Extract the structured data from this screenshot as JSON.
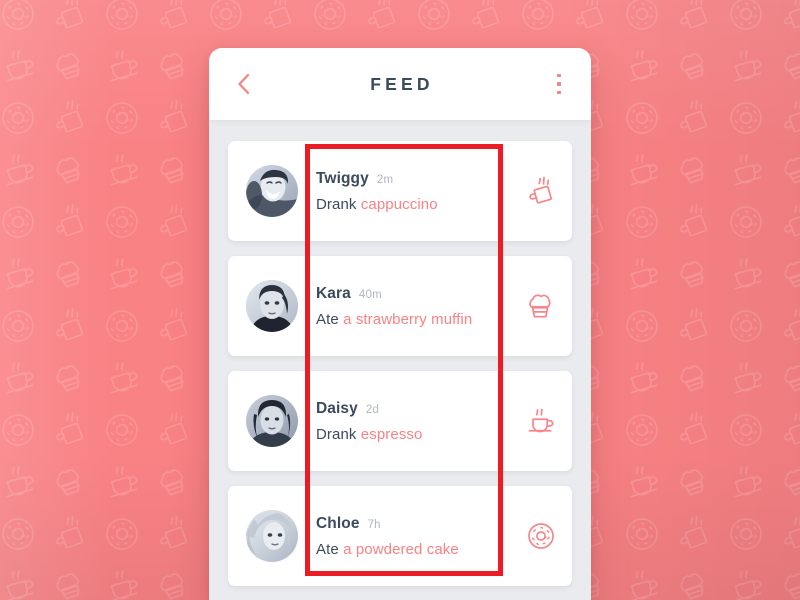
{
  "background": {
    "color": "#F98285",
    "pattern_icons": [
      "donut-icon",
      "mug-icon",
      "espresso-cup-icon",
      "muffin-icon"
    ],
    "pattern_color": "#FB9295"
  },
  "header": {
    "title": "FEED",
    "back_icon": "chevron-left-icon",
    "menu_icon": "overflow-menu-icon",
    "accent": "#F88487",
    "title_color": "#3C4A5E"
  },
  "feed": {
    "items": [
      {
        "name": "Twiggy",
        "time": "2m",
        "verb": "Drank",
        "item": "cappuccino",
        "icon": "mug-icon",
        "avatar": "avatar-twiggy"
      },
      {
        "name": "Kara",
        "time": "40m",
        "verb": "Ate",
        "item": "a strawberry muffin",
        "icon": "muffin-icon",
        "avatar": "avatar-kara"
      },
      {
        "name": "Daisy",
        "time": "2d",
        "verb": "Drank",
        "item": "espresso",
        "icon": "espresso-cup-icon",
        "avatar": "avatar-daisy"
      },
      {
        "name": "Chloe",
        "time": "7h",
        "verb": "Ate",
        "item": "a powdered cake",
        "icon": "donut-icon",
        "avatar": "avatar-chloe"
      }
    ],
    "item_color": "#FA8184",
    "text_color": "#3C4A5E",
    "time_color": "#AFB6C2"
  },
  "annotation": {
    "color": "#ED1C24",
    "shape": "rectangle"
  }
}
